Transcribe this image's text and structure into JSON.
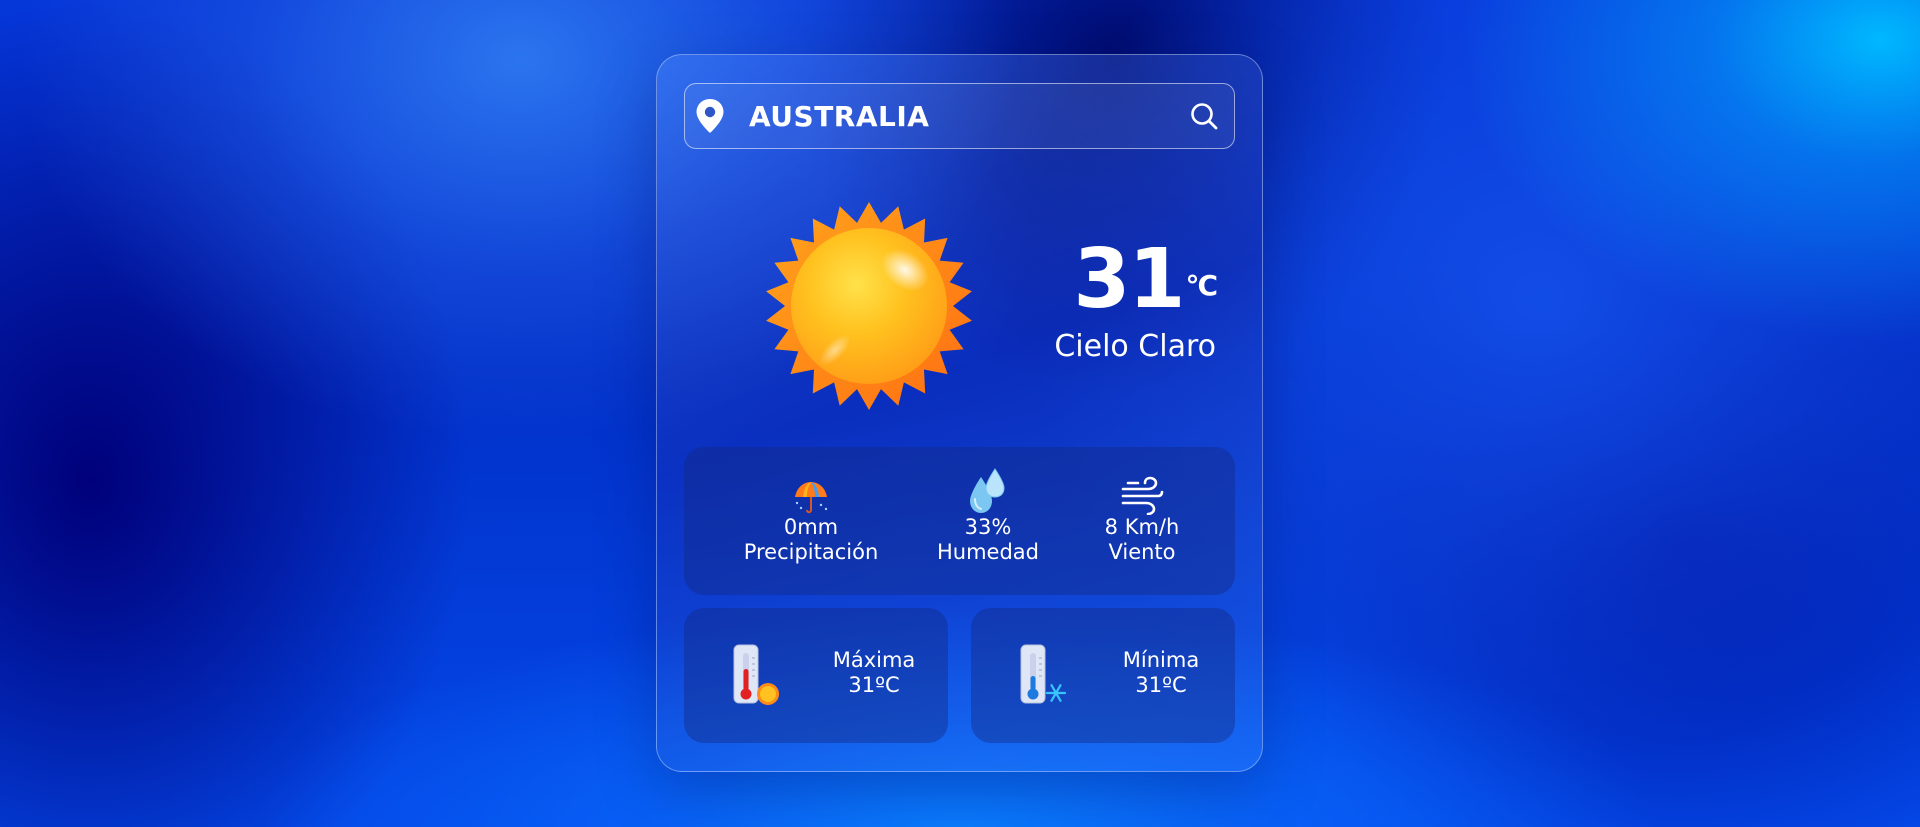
{
  "search": {
    "value": "AUSTRALIA",
    "location_icon": "map-pin-icon",
    "search_icon": "magnifier-icon"
  },
  "current": {
    "temperature": "31",
    "unit": "°C",
    "description": "Cielo Claro",
    "icon": "sun-icon"
  },
  "stats": [
    {
      "icon": "umbrella-icon",
      "value": "0mm",
      "label": "Precipitación"
    },
    {
      "icon": "water-drops-icon",
      "value": "33%",
      "label": "Humedad"
    },
    {
      "icon": "wind-icon",
      "value": "8 Km/h",
      "label": "Viento"
    }
  ],
  "max": {
    "icon": "hot-thermometer-icon",
    "label": "Máxima",
    "value": "31ºC"
  },
  "min": {
    "icon": "cold-thermometer-icon",
    "label": "Mínima",
    "value": "31ºC"
  },
  "colors": {
    "background_deep": "#0230c9",
    "background_highlight": "#00b8ff",
    "text": "#ffffff",
    "sun_core": "#ffb718",
    "sun_rays": "#ff7d1a"
  }
}
